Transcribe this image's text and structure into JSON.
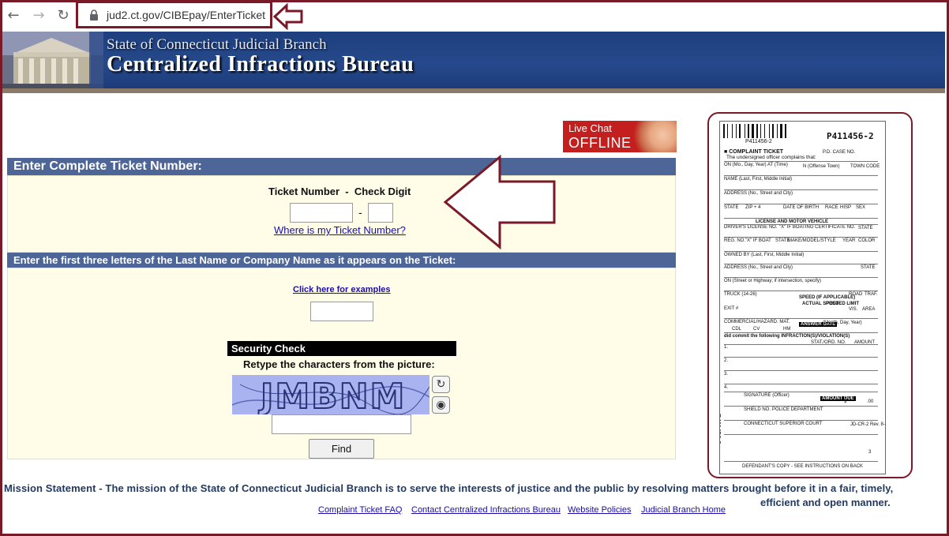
{
  "browser": {
    "url": "jud2.ct.gov/CIBEpay/EnterTicket",
    "back_icon": "arrow-left-icon",
    "forward_icon": "arrow-right-icon",
    "reload_icon": "reload-icon"
  },
  "banner": {
    "line1": "State of Connecticut Judicial Branch",
    "line2": "Centralized Infractions Bureau"
  },
  "live_chat": {
    "line1": "Live Chat",
    "line2": "OFFLINE"
  },
  "ticket_section": {
    "heading": "Enter Complete Ticket Number:",
    "label": "Ticket Number  -  Check Digit",
    "ticket_number_value": "",
    "check_digit_value": "",
    "dash": "-",
    "help_link": "Where is my Ticket Number?"
  },
  "name_section": {
    "heading": "Enter the first three letters of the Last Name or Company Name as it appears on the Ticket:",
    "examples_link": "Click here for examples",
    "name_value": ""
  },
  "security_check": {
    "heading": "Security Check",
    "instruction": "Retype the characters from the picture:",
    "captcha_text": "JMBNM",
    "captcha_value": ""
  },
  "find_button": "Find",
  "ticket_image": {
    "ticket_number": "P411456-2",
    "barcode_number": "P411456-2",
    "title": "COMPLAINT TICKET",
    "subtitle": "The undersigned officer complains that:",
    "pd_case": "P.D. CASE NO.",
    "fields": [
      "ON (Mo., Day, Year)",
      "AT (Time)",
      "N (Offense Town)",
      "TOWN CODE",
      "NAME (Last, First, Middle Initial)",
      "ADDRESS (No., Street and City)",
      "STATE",
      "ZIP + 4",
      "DATE OF BIRTH",
      "RACE",
      "HISP",
      "SEX",
      "LICENSE AND MOTOR VEHICLE",
      "DRIVER'S LICENSE NO.",
      "\"X\" IF BOATING CERTIFICATE NO.",
      "STATE",
      "REG. NO.",
      "\"X\" IF BOAT",
      "STATE",
      "MAKE/MODEL/STYLE",
      "YEAR",
      "COLOR",
      "OWNED BY (Last, First, Middle Initial)",
      "ADDRESS (No., Street and City)",
      "STATE",
      "ON (Street or Highway; if intersection, specify)",
      "TRUCK (14-26)",
      "SPEED (IF APPLICABLE)",
      "ROAD",
      "TRAF.",
      "ACTUAL SPEED",
      "POSTED LIMIT",
      "VIS.",
      "AREA",
      "EXIT #",
      "COMMERCIAL/HAZARD. MAT.",
      "CDL",
      "CV",
      "HM",
      "ANSWER DATE",
      "(Month, Day, Year)",
      "did commit the following INFRACTION(S)/VIOLATION(S)",
      "STAT./ORD. NO.",
      "AMOUNT",
      "1.",
      "2.",
      "3.",
      "4.",
      "SIGNATURE (Officer)",
      "AMOUNT DUE",
      "$",
      ".00",
      "SHIELD NO.",
      "POLICE DEPARTMENT",
      "CONNECTICUT SUPERIOR COURT",
      "JD-CR-2 Rev. 8-08",
      "DEFENDANT'S COPY - SEE INSTRUCTIONS ON BACK",
      "3"
    ]
  },
  "mission": {
    "text": "Mission Statement - The mission of the State of Connecticut Judicial Branch is to serve the interests of justice and the public by resolving matters brought before it in a fair, timely,",
    "continuation": "efficient and open manner."
  },
  "footer_links": [
    "Complaint Ticket FAQ",
    "Contact Centralized Infractions Bureau",
    "Website Policies",
    "Judicial Branch Home"
  ],
  "colors": {
    "banner": "#26498b",
    "section_head": "#4e6597",
    "panel_bg": "#fffde8",
    "annotation": "#7a1a28",
    "live_chat": "#c41f1f",
    "link": "#1a0dab"
  }
}
